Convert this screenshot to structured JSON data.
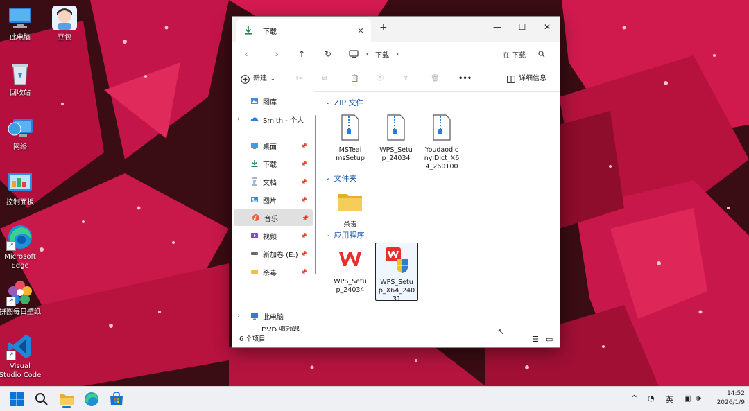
{
  "desktop": {
    "icons": [
      {
        "label": "此电脑",
        "icon": "this-pc-icon"
      },
      {
        "label": "豆包",
        "icon": "doubao-avatar-icon"
      },
      {
        "label": "回收站",
        "icon": "recycle-bin-icon"
      },
      {
        "label": "网络",
        "icon": "network-icon"
      },
      {
        "label": "控制面板",
        "icon": "control-panel-icon"
      },
      {
        "label": "Microsoft Edge",
        "icon": "edge-icon"
      },
      {
        "label": "拼图每日壁纸",
        "icon": "wallpaper-app-icon"
      },
      {
        "label": "Visual Studio Code",
        "icon": "vscode-icon"
      }
    ]
  },
  "explorer": {
    "tab_label": "下载",
    "tab_close": "×",
    "new_tab": "+",
    "window_controls": {
      "minimize": "—",
      "maximize": "☐",
      "close": "✕"
    },
    "nav": {
      "back": "‹",
      "forward": "›",
      "up": "↑",
      "refresh": "↻"
    },
    "breadcrumb": [
      "下载"
    ],
    "search_placeholder": "在 下载",
    "commands": {
      "new": "新建",
      "details": "详细信息",
      "more": "•••"
    },
    "nav_pane": {
      "top": [
        {
          "label": "图库",
          "icon": "gallery-icon",
          "chevron": ""
        },
        {
          "label": "Smith - 个人",
          "icon": "onedrive-cloud-icon",
          "chevron": "›"
        }
      ],
      "quick_access": [
        {
          "label": "桌面",
          "icon": "desktop-folder-icon",
          "pin": "📌"
        },
        {
          "label": "下载",
          "icon": "download-folder-icon",
          "pin": "📌"
        },
        {
          "label": "文档",
          "icon": "documents-folder-icon",
          "pin": "📌"
        },
        {
          "label": "图片",
          "icon": "pictures-folder-icon",
          "pin": "📌"
        },
        {
          "label": "音乐",
          "icon": "music-folder-icon",
          "pin": "📌"
        },
        {
          "label": "视频",
          "icon": "videos-folder-icon",
          "pin": "📌"
        },
        {
          "label": "新加卷 (E:)",
          "icon": "drive-icon",
          "pin": "📌"
        },
        {
          "label": "杀毒",
          "icon": "folder-icon",
          "pin": "📌"
        }
      ],
      "bottom": [
        {
          "label": "此电脑",
          "icon": "this-pc-icon",
          "chevron": "›"
        },
        {
          "label": "DVD 驱动器 (D:)",
          "icon": "dvd-drive-icon",
          "chevron": "›"
        }
      ]
    },
    "groups": [
      {
        "title": "ZIP 文件",
        "items": [
          {
            "name": "MSTeamsSetup",
            "lines": [
              "MSTeai",
              "msSetup"
            ],
            "icon": "zip-file-icon"
          },
          {
            "name": "WPS_Setup_24034",
            "lines": [
              "WPS_Setu",
              "p_24034"
            ],
            "icon": "zip-file-icon"
          },
          {
            "name": "YoudaoDict_x64_260100",
            "lines": [
              "Youdaodic",
              "nyiDict_X6",
              "4_260100"
            ],
            "icon": "zip-file-icon"
          }
        ]
      },
      {
        "title": "文件夹",
        "items": [
          {
            "name": "杀毒",
            "lines": [
              "杀毒"
            ],
            "icon": "folder-icon"
          }
        ]
      },
      {
        "title": "应用程序",
        "items": [
          {
            "name": "WPS_Setup_24034",
            "lines": [
              "WPS_Setu",
              "p_24034"
            ],
            "icon": "wps-app-icon"
          },
          {
            "name": "WPS_Setup_X64_24031",
            "lines": [
              "WPS_Setu",
              "p_X64_240",
              "31"
            ],
            "icon": "wps-installer-icon",
            "selected": true
          }
        ]
      }
    ],
    "status": "6 个项目"
  },
  "taskbar": {
    "items": [
      "start-icon",
      "search-icon",
      "file-explorer-icon",
      "edge-icon",
      "store-icon"
    ],
    "tray": {
      "chevron": "^",
      "ime": "英"
    },
    "clock": {
      "time": "14:52",
      "date": "2026/1/9"
    }
  }
}
